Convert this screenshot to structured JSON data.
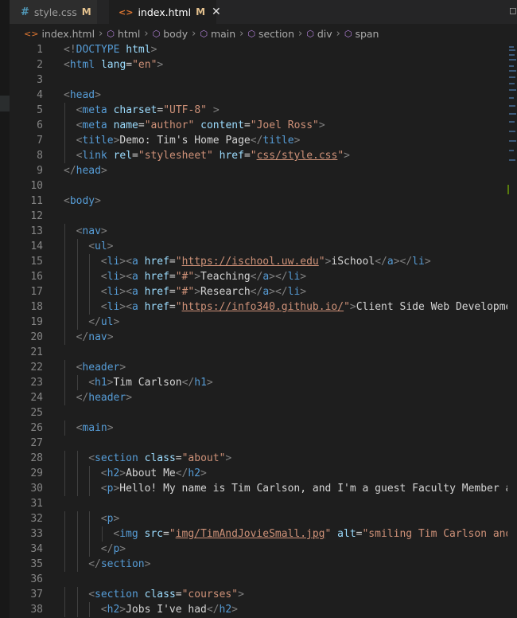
{
  "tabs": [
    {
      "name": "style.css",
      "status": "M",
      "icon": "css-file-icon",
      "active": false
    },
    {
      "name": "index.html",
      "status": "M",
      "icon": "html-file-icon",
      "active": true
    }
  ],
  "breadcrumbs": [
    {
      "label": "index.html",
      "icon": "html-file-icon"
    },
    {
      "label": "html",
      "icon": "element-icon"
    },
    {
      "label": "body",
      "icon": "element-icon"
    },
    {
      "label": "main",
      "icon": "element-icon"
    },
    {
      "label": "section",
      "icon": "element-icon"
    },
    {
      "label": "div",
      "icon": "element-icon"
    },
    {
      "label": "span",
      "icon": "element-icon"
    }
  ],
  "lines": [
    {
      "n": "1",
      "indent": 1,
      "seg": [
        [
          "br",
          "<!"
        ],
        [
          "tag",
          "DOCTYPE"
        ],
        [
          "txt",
          " "
        ],
        [
          "attr",
          "html"
        ],
        [
          "br",
          ">"
        ]
      ]
    },
    {
      "n": "2",
      "indent": 1,
      "seg": [
        [
          "br",
          "<"
        ],
        [
          "tag",
          "html"
        ],
        [
          "txt",
          " "
        ],
        [
          "attr",
          "lang"
        ],
        [
          "txt",
          "="
        ],
        [
          "str",
          "\"en\""
        ],
        [
          "br",
          ">"
        ]
      ]
    },
    {
      "n": "3",
      "indent": 0,
      "seg": []
    },
    {
      "n": "4",
      "indent": 1,
      "seg": [
        [
          "br",
          "<"
        ],
        [
          "tag",
          "head"
        ],
        [
          "br",
          ">"
        ]
      ]
    },
    {
      "n": "5",
      "indent": 2,
      "seg": [
        [
          "br",
          "<"
        ],
        [
          "tag",
          "meta"
        ],
        [
          "txt",
          " "
        ],
        [
          "attr",
          "charset"
        ],
        [
          "txt",
          "="
        ],
        [
          "str",
          "\"UTF-8\""
        ],
        [
          "txt",
          " "
        ],
        [
          "br",
          ">"
        ]
      ]
    },
    {
      "n": "6",
      "indent": 2,
      "seg": [
        [
          "br",
          "<"
        ],
        [
          "tag",
          "meta"
        ],
        [
          "txt",
          " "
        ],
        [
          "attr",
          "name"
        ],
        [
          "txt",
          "="
        ],
        [
          "str",
          "\"author\""
        ],
        [
          "txt",
          " "
        ],
        [
          "attr",
          "content"
        ],
        [
          "txt",
          "="
        ],
        [
          "str",
          "\"Joel Ross\""
        ],
        [
          "br",
          ">"
        ]
      ]
    },
    {
      "n": "7",
      "indent": 2,
      "seg": [
        [
          "br",
          "<"
        ],
        [
          "tag",
          "title"
        ],
        [
          "br",
          ">"
        ],
        [
          "txt",
          "Demo: Tim's Home Page"
        ],
        [
          "br",
          "</"
        ],
        [
          "tag",
          "title"
        ],
        [
          "br",
          ">"
        ]
      ]
    },
    {
      "n": "8",
      "indent": 2,
      "seg": [
        [
          "br",
          "<"
        ],
        [
          "tag",
          "link"
        ],
        [
          "txt",
          " "
        ],
        [
          "attr",
          "rel"
        ],
        [
          "txt",
          "="
        ],
        [
          "str",
          "\"stylesheet\""
        ],
        [
          "txt",
          " "
        ],
        [
          "attr",
          "href"
        ],
        [
          "txt",
          "="
        ],
        [
          "str",
          "\""
        ],
        [
          "url",
          "css/style.css"
        ],
        [
          "str",
          "\""
        ],
        [
          "br",
          ">"
        ]
      ]
    },
    {
      "n": "9",
      "indent": 1,
      "seg": [
        [
          "br",
          "</"
        ],
        [
          "tag",
          "head"
        ],
        [
          "br",
          ">"
        ]
      ]
    },
    {
      "n": "10",
      "indent": 0,
      "seg": []
    },
    {
      "n": "11",
      "indent": 1,
      "seg": [
        [
          "br",
          "<"
        ],
        [
          "tag",
          "body"
        ],
        [
          "br",
          ">"
        ]
      ]
    },
    {
      "n": "12",
      "indent": 0,
      "seg": []
    },
    {
      "n": "13",
      "indent": 2,
      "seg": [
        [
          "br",
          "<"
        ],
        [
          "tag",
          "nav"
        ],
        [
          "br",
          ">"
        ]
      ]
    },
    {
      "n": "14",
      "indent": 3,
      "seg": [
        [
          "br",
          "<"
        ],
        [
          "tag",
          "ul"
        ],
        [
          "br",
          ">"
        ]
      ]
    },
    {
      "n": "15",
      "indent": 4,
      "seg": [
        [
          "br",
          "<"
        ],
        [
          "tag",
          "li"
        ],
        [
          "br",
          "><"
        ],
        [
          "tag",
          "a"
        ],
        [
          "txt",
          " "
        ],
        [
          "attr",
          "href"
        ],
        [
          "txt",
          "="
        ],
        [
          "str",
          "\""
        ],
        [
          "url",
          "https://ischool.uw.edu"
        ],
        [
          "str",
          "\""
        ],
        [
          "br",
          ">"
        ],
        [
          "txt",
          "iSchool"
        ],
        [
          "br",
          "</"
        ],
        [
          "tag",
          "a"
        ],
        [
          "br",
          "></"
        ],
        [
          "tag",
          "li"
        ],
        [
          "br",
          ">"
        ]
      ]
    },
    {
      "n": "16",
      "indent": 4,
      "seg": [
        [
          "br",
          "<"
        ],
        [
          "tag",
          "li"
        ],
        [
          "br",
          "><"
        ],
        [
          "tag",
          "a"
        ],
        [
          "txt",
          " "
        ],
        [
          "attr",
          "href"
        ],
        [
          "txt",
          "="
        ],
        [
          "str",
          "\"#\""
        ],
        [
          "br",
          ">"
        ],
        [
          "txt",
          "Teaching"
        ],
        [
          "br",
          "</"
        ],
        [
          "tag",
          "a"
        ],
        [
          "br",
          "></"
        ],
        [
          "tag",
          "li"
        ],
        [
          "br",
          ">"
        ]
      ]
    },
    {
      "n": "17",
      "indent": 4,
      "seg": [
        [
          "br",
          "<"
        ],
        [
          "tag",
          "li"
        ],
        [
          "br",
          "><"
        ],
        [
          "tag",
          "a"
        ],
        [
          "txt",
          " "
        ],
        [
          "attr",
          "href"
        ],
        [
          "txt",
          "="
        ],
        [
          "str",
          "\"#\""
        ],
        [
          "br",
          ">"
        ],
        [
          "txt",
          "Research"
        ],
        [
          "br",
          "</"
        ],
        [
          "tag",
          "a"
        ],
        [
          "br",
          "></"
        ],
        [
          "tag",
          "li"
        ],
        [
          "br",
          ">"
        ]
      ]
    },
    {
      "n": "18",
      "indent": 4,
      "seg": [
        [
          "br",
          "<"
        ],
        [
          "tag",
          "li"
        ],
        [
          "br",
          "><"
        ],
        [
          "tag",
          "a"
        ],
        [
          "txt",
          " "
        ],
        [
          "attr",
          "href"
        ],
        [
          "txt",
          "="
        ],
        [
          "str",
          "\""
        ],
        [
          "url",
          "https://info340.github.io/"
        ],
        [
          "str",
          "\""
        ],
        [
          "br",
          ">"
        ],
        [
          "txt",
          "Client Side Web Developme"
        ]
      ]
    },
    {
      "n": "19",
      "indent": 3,
      "seg": [
        [
          "br",
          "</"
        ],
        [
          "tag",
          "ul"
        ],
        [
          "br",
          ">"
        ]
      ]
    },
    {
      "n": "20",
      "indent": 2,
      "seg": [
        [
          "br",
          "</"
        ],
        [
          "tag",
          "nav"
        ],
        [
          "br",
          ">"
        ]
      ]
    },
    {
      "n": "21",
      "indent": 0,
      "seg": []
    },
    {
      "n": "22",
      "indent": 2,
      "seg": [
        [
          "br",
          "<"
        ],
        [
          "tag",
          "header"
        ],
        [
          "br",
          ">"
        ]
      ]
    },
    {
      "n": "23",
      "indent": 3,
      "seg": [
        [
          "br",
          "<"
        ],
        [
          "tag",
          "h1"
        ],
        [
          "br",
          ">"
        ],
        [
          "txt",
          "Tim Carlson"
        ],
        [
          "br",
          "</"
        ],
        [
          "tag",
          "h1"
        ],
        [
          "br",
          ">"
        ]
      ]
    },
    {
      "n": "24",
      "indent": 2,
      "seg": [
        [
          "br",
          "</"
        ],
        [
          "tag",
          "header"
        ],
        [
          "br",
          ">"
        ]
      ]
    },
    {
      "n": "25",
      "indent": 0,
      "seg": []
    },
    {
      "n": "26",
      "indent": 2,
      "seg": [
        [
          "br",
          "<"
        ],
        [
          "tag",
          "main"
        ],
        [
          "br",
          ">"
        ]
      ]
    },
    {
      "n": "27",
      "indent": 0,
      "seg": []
    },
    {
      "n": "28",
      "indent": 3,
      "seg": [
        [
          "br",
          "<"
        ],
        [
          "tag",
          "section"
        ],
        [
          "txt",
          " "
        ],
        [
          "attr",
          "class"
        ],
        [
          "txt",
          "="
        ],
        [
          "str",
          "\"about\""
        ],
        [
          "br",
          ">"
        ]
      ]
    },
    {
      "n": "29",
      "indent": 4,
      "seg": [
        [
          "br",
          "<"
        ],
        [
          "tag",
          "h2"
        ],
        [
          "br",
          ">"
        ],
        [
          "txt",
          "About Me"
        ],
        [
          "br",
          "</"
        ],
        [
          "tag",
          "h2"
        ],
        [
          "br",
          ">"
        ]
      ]
    },
    {
      "n": "30",
      "indent": 4,
      "seg": [
        [
          "br",
          "<"
        ],
        [
          "tag",
          "p"
        ],
        [
          "br",
          ">"
        ],
        [
          "txt",
          "Hello! My name is Tim Carlson, and I'm a guest Faculty Member a"
        ]
      ]
    },
    {
      "n": "31",
      "indent": 0,
      "seg": []
    },
    {
      "n": "32",
      "indent": 4,
      "seg": [
        [
          "br",
          "<"
        ],
        [
          "tag",
          "p"
        ],
        [
          "br",
          ">"
        ]
      ]
    },
    {
      "n": "33",
      "indent": 5,
      "seg": [
        [
          "br",
          "<"
        ],
        [
          "tag",
          "img"
        ],
        [
          "txt",
          " "
        ],
        [
          "attr",
          "src"
        ],
        [
          "txt",
          "="
        ],
        [
          "str",
          "\""
        ],
        [
          "url",
          "img/TimAndJovieSmall.jpg"
        ],
        [
          "str",
          "\""
        ],
        [
          "txt",
          " "
        ],
        [
          "attr",
          "alt"
        ],
        [
          "txt",
          "="
        ],
        [
          "str",
          "\"smiling Tim Carlson and"
        ]
      ]
    },
    {
      "n": "34",
      "indent": 4,
      "seg": [
        [
          "br",
          "</"
        ],
        [
          "tag",
          "p"
        ],
        [
          "br",
          ">"
        ]
      ]
    },
    {
      "n": "35",
      "indent": 3,
      "seg": [
        [
          "br",
          "</"
        ],
        [
          "tag",
          "section"
        ],
        [
          "br",
          ">"
        ]
      ]
    },
    {
      "n": "36",
      "indent": 0,
      "seg": []
    },
    {
      "n": "37",
      "indent": 3,
      "seg": [
        [
          "br",
          "<"
        ],
        [
          "tag",
          "section"
        ],
        [
          "txt",
          " "
        ],
        [
          "attr",
          "class"
        ],
        [
          "txt",
          "="
        ],
        [
          "str",
          "\"courses\""
        ],
        [
          "br",
          ">"
        ]
      ]
    },
    {
      "n": "38",
      "indent": 4,
      "seg": [
        [
          "br",
          "<"
        ],
        [
          "tag",
          "h2"
        ],
        [
          "br",
          ">"
        ],
        [
          "txt",
          "Jobs I've had"
        ],
        [
          "br",
          "</"
        ],
        [
          "tag",
          "h2"
        ],
        [
          "br",
          ">"
        ]
      ]
    }
  ],
  "colors": {
    "background": "#1e1e1e",
    "tag": "#569cd6",
    "attr": "#9cdcfe",
    "string": "#ce9178",
    "text": "#d4d4d4",
    "bracket": "#808080"
  }
}
